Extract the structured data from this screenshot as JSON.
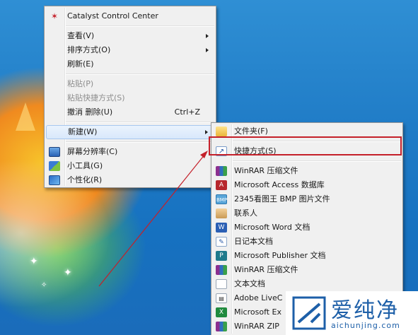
{
  "context_menu": {
    "items": [
      {
        "label": "Catalyst Control Center",
        "icon": "catalyst-icon"
      },
      {
        "label": "查看(V)",
        "submenu": true
      },
      {
        "label": "排序方式(O)",
        "submenu": true
      },
      {
        "label": "刷新(E)"
      },
      {
        "label": "粘贴(P)",
        "disabled": true
      },
      {
        "label": "粘贴快捷方式(S)",
        "disabled": true
      },
      {
        "label": "撤消 删除(U)",
        "shortcut": "Ctrl+Z"
      },
      {
        "label": "新建(W)",
        "submenu": true,
        "highlighted": true
      },
      {
        "label": "屏幕分辨率(C)",
        "icon": "monitor-icon"
      },
      {
        "label": "小工具(G)",
        "icon": "gadgets-icon"
      },
      {
        "label": "个性化(R)",
        "icon": "personalize-icon"
      }
    ]
  },
  "new_submenu": {
    "items": [
      {
        "label": "文件夹(F)",
        "icon": "folder-icon"
      },
      {
        "label": "快捷方式(S)",
        "icon": "shortcut-icon"
      },
      {
        "label": "WinRAR 压缩文件",
        "icon": "winrar-icon"
      },
      {
        "label": "Microsoft Access 数据库",
        "icon": "access-icon"
      },
      {
        "label": "2345看图王 BMP 图片文件",
        "icon": "bmp-icon"
      },
      {
        "label": "联系人",
        "icon": "contact-icon"
      },
      {
        "label": "Microsoft Word 文档",
        "icon": "word-icon"
      },
      {
        "label": "日记本文档",
        "icon": "journal-icon"
      },
      {
        "label": "Microsoft Publisher 文档",
        "icon": "publisher-icon"
      },
      {
        "label": "WinRAR 压缩文件",
        "icon": "winrar-icon"
      },
      {
        "label": "文本文档",
        "icon": "text-icon"
      },
      {
        "label": "Adobe LiveC",
        "icon": "adobe-icon"
      },
      {
        "label": "Microsoft Ex",
        "icon": "excel-icon"
      },
      {
        "label": "WinRAR ZIP ",
        "icon": "winrar-zip-icon"
      }
    ]
  },
  "watermark": {
    "brand": "爱纯净",
    "url": "aichunjing.com"
  },
  "colors": {
    "callout": "#c4202a",
    "menu_bg": "#f0f0f0",
    "highlight": "#d9e8fb",
    "watermark": "#1d5fa8"
  }
}
